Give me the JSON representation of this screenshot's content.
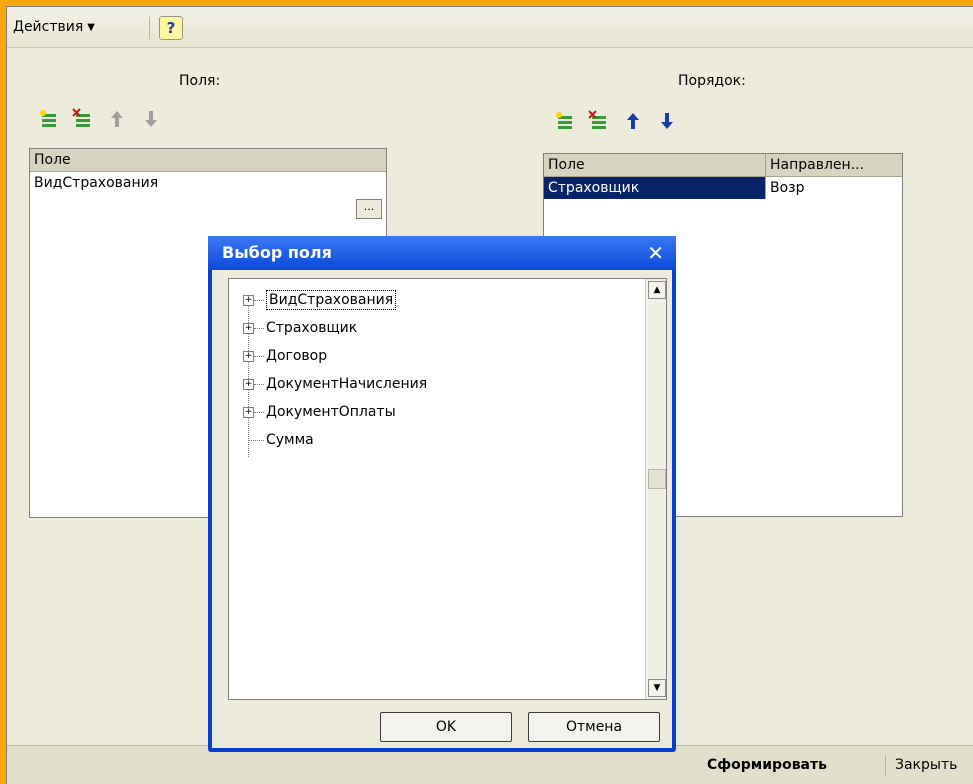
{
  "toolbar": {
    "actions_label": "Действия",
    "help_label": "?"
  },
  "fields_panel": {
    "label": "Поля:",
    "column_header": "Поле",
    "rows": [
      "ВидСтрахования"
    ],
    "ellipsis_label": "..."
  },
  "order_panel": {
    "label": "Порядок:",
    "column_headers": [
      "Поле",
      "Направлен..."
    ],
    "rows": [
      [
        "Страховщик",
        "Возр"
      ]
    ]
  },
  "dialog": {
    "title": "Выбор поля",
    "close_label": "✕",
    "tree": [
      "ВидСтрахования",
      "Страховщик",
      "Договор",
      "ДокументНачисления",
      "ДокументОплаты",
      "Сумма"
    ],
    "ok_label": "OK",
    "cancel_label": "Отмена"
  },
  "status": {
    "generate_label": "Сформировать",
    "close_label": "Закрыть"
  },
  "colors": {
    "frame_border": "#f7a80f",
    "selection": "#0a246a",
    "dialog_title": "#0a4ad8"
  }
}
